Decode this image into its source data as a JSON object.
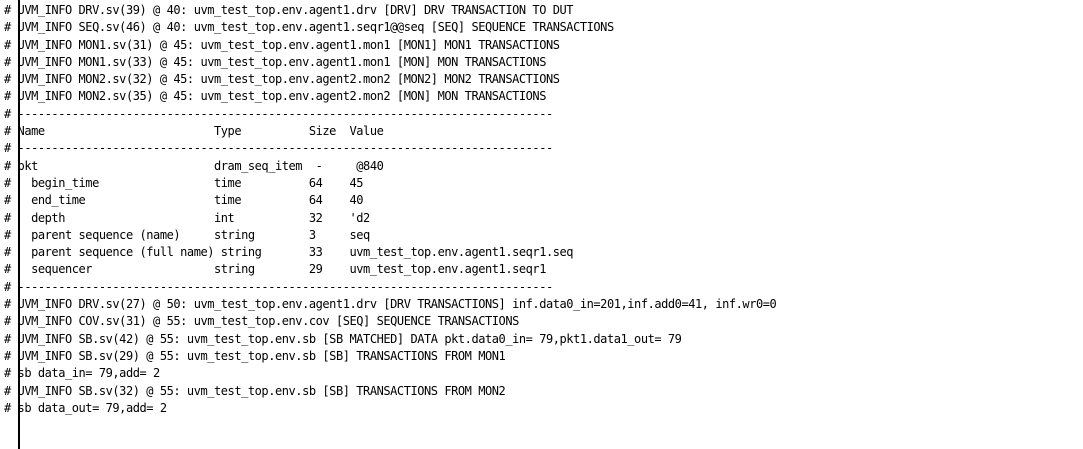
{
  "console": {
    "lines": [
      "# UVM_INFO DRV.sv(39) @ 40: uvm_test_top.env.agent1.drv [DRV] DRV TRANSACTION TO DUT",
      "# UVM_INFO SEQ.sv(46) @ 40: uvm_test_top.env.agent1.seqr1@@seq [SEQ] SEQUENCE TRANSACTIONS",
      "# UVM_INFO MON1.sv(31) @ 45: uvm_test_top.env.agent1.mon1 [MON1] MON1 TRANSACTIONS",
      "# UVM_INFO MON1.sv(33) @ 45: uvm_test_top.env.agent1.mon1 [MON] MON TRANSACTIONS",
      "# UVM_INFO MON2.sv(32) @ 45: uvm_test_top.env.agent2.mon2 [MON2] MON2 TRANSACTIONS",
      "# UVM_INFO MON2.sv(35) @ 45: uvm_test_top.env.agent2.mon2 [MON] MON TRANSACTIONS",
      "# -------------------------------------------------------------------------------",
      "# Name                         Type          Size  Value",
      "# -------------------------------------------------------------------------------",
      "# pkt                          dram_seq_item  -     @840",
      "#   begin_time                 time          64    45",
      "#   end_time                   time          64    40",
      "#   depth                      int           32    'd2",
      "#   parent sequence (name)     string        3     seq",
      "#   parent sequence (full name) string       33    uvm_test_top.env.agent1.seqr1.seq",
      "#   sequencer                  string        29    uvm_test_top.env.agent1.seqr1",
      "# -------------------------------------------------------------------------------",
      "# UVM_INFO DRV.sv(27) @ 50: uvm_test_top.env.agent1.drv [DRV TRANSACTIONS] inf.data0_in=201,inf.add0=41, inf.wr0=0",
      "# UVM_INFO COV.sv(31) @ 55: uvm_test_top.env.cov [SEQ] SEQUENCE TRANSACTIONS",
      "# UVM_INFO SB.sv(42) @ 55: uvm_test_top.env.sb [SB MATCHED] DATA pkt.data0_in= 79,pkt1.data1_out= 79",
      "# UVM_INFO SB.sv(29) @ 55: uvm_test_top.env.sb [SB] TRANSACTIONS FROM MON1",
      "# sb data_in= 79,add= 2",
      "# UVM_INFO SB.sv(32) @ 55: uvm_test_top.env.sb [SB] TRANSACTIONS FROM MON2",
      "# sb data_out= 79,add= 2"
    ]
  }
}
